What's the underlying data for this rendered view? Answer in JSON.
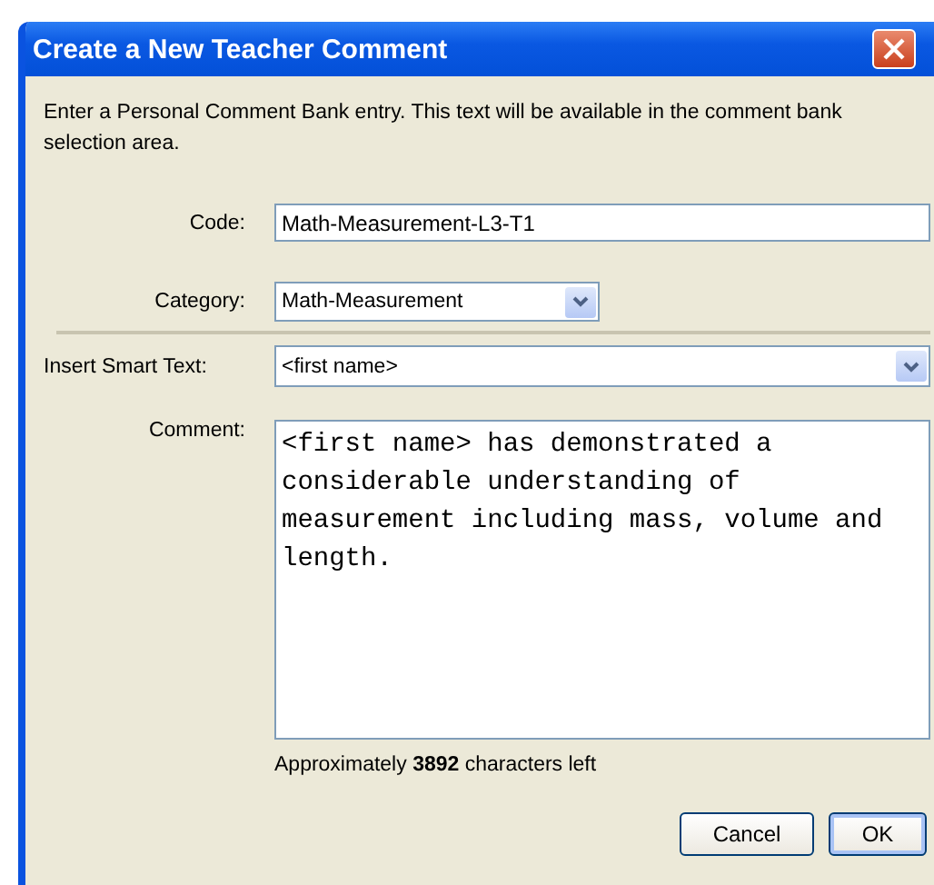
{
  "window": {
    "title": "Create a New Teacher Comment"
  },
  "intro": "Enter a Personal Comment Bank entry. This text will be available in the comment bank selection area.",
  "fields": [
    {
      "kind": "text",
      "label": "Code:",
      "value": "Math-Measurement-L3-T1"
    },
    {
      "kind": "select",
      "label": "Category:",
      "value": "Math-Measurement"
    },
    {
      "kind": "divider"
    },
    {
      "kind": "select-wide",
      "label": "Insert Smart Text:",
      "value": "<first name>"
    },
    {
      "kind": "textarea",
      "label": "Comment:",
      "value": "<first name> has demonstrated a considerable understanding of measurement including mass, volume and length."
    }
  ],
  "chars_left": "Approximately **3892** characters left",
  "buttons": [
    "Cancel",
    "OK"
  ]
}
